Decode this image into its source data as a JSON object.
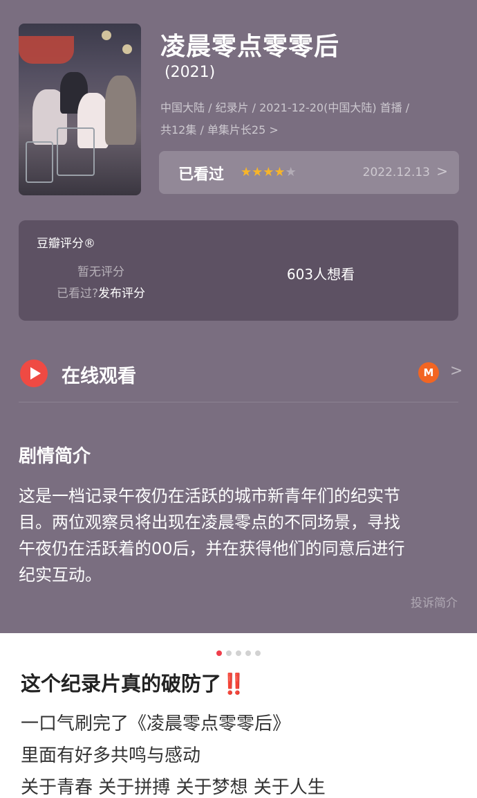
{
  "show": {
    "title": "凌晨零点零零后",
    "year": "(2021)",
    "meta_line1": "中国大陆 / 纪录片 / 2021-12-20(中国大陆) 首播 /",
    "meta_line2": "共12集 / 单集片长25",
    "meta_chevron": ">"
  },
  "watched": {
    "label": "已看过",
    "stars_filled": 4,
    "stars_total": 5,
    "star_glyph": "★",
    "date": "2022.12.13",
    "chevron": ">"
  },
  "rating": {
    "title": "豆瓣评分®",
    "none_text": "暂无评分",
    "watched_question": "已看过?",
    "publish_link": "发布评分",
    "want_count": "603人想看"
  },
  "online": {
    "label": "在线观看",
    "icon": "play-icon",
    "platform_icon": "mgtv-icon",
    "platform_glyph": "M",
    "chevron": ">"
  },
  "synopsis": {
    "title": "剧情简介",
    "lines": [
      "这是一档记录午夜仍在活跃的城市新青年们的纪实节",
      "目。两位观察员将出现在凌晨零点的不同场景，寻找",
      "午夜仍在活跃着的00后，并在获得他们的同意后进行",
      "纪实互动。"
    ],
    "report_link": "投诉简介"
  },
  "carousel": {
    "count": 5,
    "active_index": 0
  },
  "post": {
    "title": "这个纪录片真的破防了",
    "title_emoji": "‼️",
    "lines": [
      "一口气刷完了《凌晨零点零零后》",
      "里面有好多共鸣与感动",
      "关于青春 关于拼搏 关于梦想 关于人生"
    ]
  },
  "colors": {
    "header_bg": "#7a6e80",
    "star": "#f7b529",
    "play": "#ef4a43",
    "mgtv": "#f26522",
    "dot_active": "#ef3e4b"
  }
}
